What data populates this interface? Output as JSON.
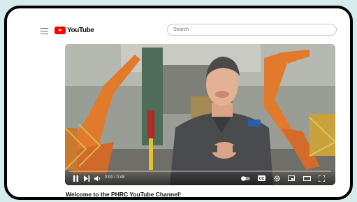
{
  "header": {
    "logo_text": "YouTube",
    "search_placeholder": "Search"
  },
  "player": {
    "time": "0:00 / 0:48",
    "progress": 0.0
  },
  "video_title": "Welcome to the PHRC YouTube Channel!",
  "icons": [
    "menu-icon",
    "youtube-logo-icon",
    "play-icon",
    "next-icon",
    "volume-icon",
    "autoplay-toggle-icon",
    "captions-icon",
    "settings-icon",
    "miniplayer-icon",
    "theater-icon",
    "fullscreen-icon"
  ],
  "colors": {
    "background": "#d6ecec",
    "brand_red": "#ff0000",
    "frame": "#000000"
  }
}
